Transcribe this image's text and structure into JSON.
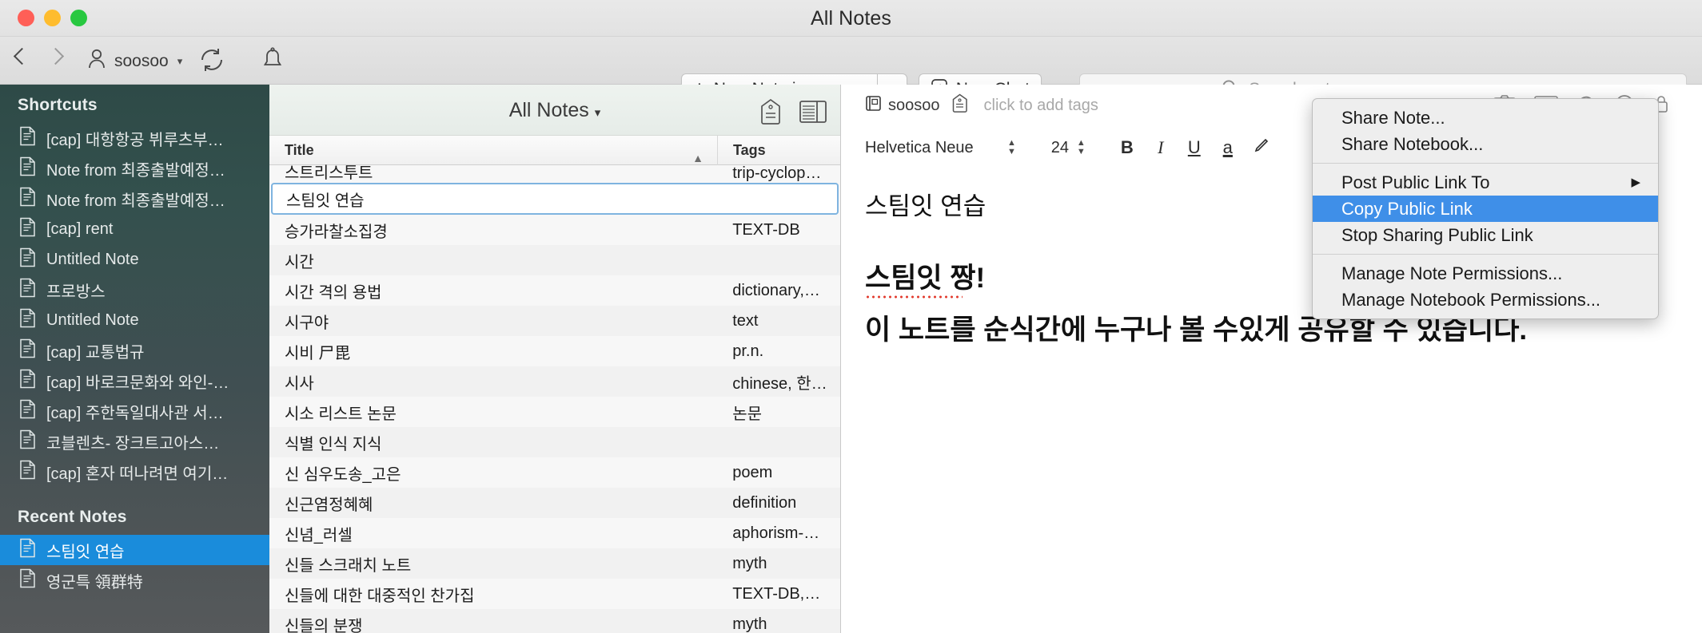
{
  "window": {
    "title": "All Notes"
  },
  "toolbar": {
    "account_name": "soosoo",
    "new_note_label": "New Note in soosoo",
    "new_chat_label": "New Chat",
    "search_placeholder": "Search notes"
  },
  "sidebar": {
    "shortcuts_header": "Shortcuts",
    "shortcuts": [
      {
        "label": "[cap] 대항항공 뷔루츠부…"
      },
      {
        "label": "Note from 최종출발예정…"
      },
      {
        "label": "Note from 최종출발예정…"
      },
      {
        "label": "[cap] rent"
      },
      {
        "label": "Untitled Note"
      },
      {
        "label": "프로방스"
      },
      {
        "label": "Untitled Note"
      },
      {
        "label": "[cap] 교통법규"
      },
      {
        "label": "[cap] 바로크문화와 와인-…"
      },
      {
        "label": "[cap] 주한독일대사관 서…"
      },
      {
        "label": "코블렌츠- 장크트고아스…"
      },
      {
        "label": "[cap] 혼자 떠나려면 여기…"
      }
    ],
    "recent_header": "Recent Notes",
    "recent": [
      {
        "label": "스팀잇 연습",
        "selected": true
      },
      {
        "label": "영군특 領群特",
        "selected": false
      }
    ]
  },
  "notelist": {
    "title": "All Notes",
    "columns": {
      "title": "Title",
      "tags": "Tags"
    },
    "rows": [
      {
        "title": "스트리스투트",
        "tags": "trip-cyclop…",
        "partial": true
      },
      {
        "title": "스팀잇 연습",
        "tags": "",
        "selected": true
      },
      {
        "title": "승가라찰소집경",
        "tags": "TEXT-DB"
      },
      {
        "title": "시간",
        "tags": ""
      },
      {
        "title": "시간 격의 용법",
        "tags": "dictionary,…"
      },
      {
        "title": "시구야",
        "tags": "text"
      },
      {
        "title": "시비 尸毘",
        "tags": "pr.n."
      },
      {
        "title": "시사",
        "tags": "chinese, 한…"
      },
      {
        "title": "시소 리스트 논문",
        "tags": "논문"
      },
      {
        "title": "식별 인식 지식",
        "tags": ""
      },
      {
        "title": "신 심우도송_고은",
        "tags": "poem"
      },
      {
        "title": "신근염정혜혜",
        "tags": "definition"
      },
      {
        "title": "신념_러셀",
        "tags": "aphorism-…"
      },
      {
        "title": "신들 스크래치 노트",
        "tags": "myth"
      },
      {
        "title": "신들에 대한 대중적인 찬가집",
        "tags": "TEXT-DB,…"
      },
      {
        "title": "신들의 분쟁",
        "tags": "myth"
      }
    ]
  },
  "editor": {
    "notebook_name": "soosoo",
    "add_tags_placeholder": "click to add tags",
    "font_name": "Helvetica Neue",
    "font_size": "24",
    "format_bold": "B",
    "format_italic": "I",
    "format_underline": "U",
    "format_textcolor": "a",
    "note_title": "스팀잇 연습",
    "body_line_1": "스팀잇 짱!",
    "body_line_2": "이 노트를 순식간에 누구나 볼 수있게 공유할 수 있습니다."
  },
  "context_menu": {
    "items": [
      {
        "label": "Share Note...",
        "type": "item"
      },
      {
        "label": "Share Notebook...",
        "type": "item"
      },
      {
        "type": "separator"
      },
      {
        "label": "Post Public Link To",
        "type": "submenu"
      },
      {
        "label": "Copy Public Link",
        "type": "item",
        "highlighted": true
      },
      {
        "label": "Stop Sharing Public Link",
        "type": "item"
      },
      {
        "type": "separator"
      },
      {
        "label": "Manage Note Permissions...",
        "type": "item"
      },
      {
        "label": "Manage Notebook Permissions...",
        "type": "item"
      }
    ]
  },
  "colors": {
    "highlight_blue": "#3f8fe8",
    "sidebar_selected": "#1a8cdb",
    "sidebar_top": "#2e4a47"
  }
}
